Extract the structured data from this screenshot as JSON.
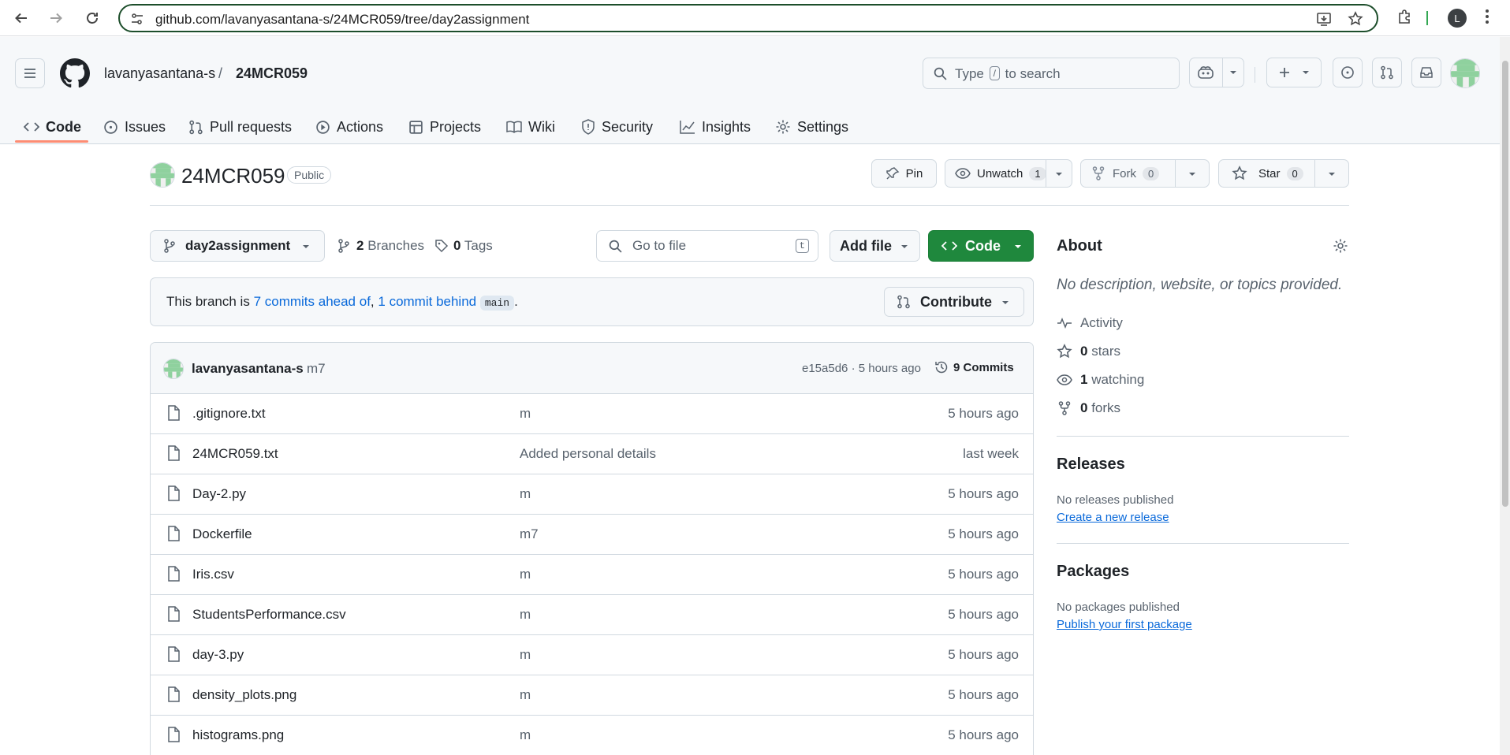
{
  "browser": {
    "url": "github.com/lavanyasantana-s/24MCR059/tree/day2assignment",
    "profile_initial": "L"
  },
  "header": {
    "owner": "lavanyasantana-s",
    "separator": "/",
    "repo": "24MCR059",
    "search_prefix": "Type",
    "search_key": "/",
    "search_suffix": "to search"
  },
  "tabs": [
    {
      "label": "Code",
      "icon": "code-icon"
    },
    {
      "label": "Issues",
      "icon": "issue-icon"
    },
    {
      "label": "Pull requests",
      "icon": "pull-request-icon"
    },
    {
      "label": "Actions",
      "icon": "play-icon"
    },
    {
      "label": "Projects",
      "icon": "table-icon"
    },
    {
      "label": "Wiki",
      "icon": "book-icon"
    },
    {
      "label": "Security",
      "icon": "shield-icon"
    },
    {
      "label": "Insights",
      "icon": "graph-icon"
    },
    {
      "label": "Settings",
      "icon": "gear-icon"
    }
  ],
  "repo": {
    "name": "24MCR059",
    "visibility": "Public",
    "pin_label": "Pin",
    "unwatch_label": "Unwatch",
    "watch_count": "1",
    "fork_label": "Fork",
    "fork_count": "0",
    "star_label": "Star",
    "star_count": "0"
  },
  "toolbar": {
    "branch": "day2assignment",
    "branches_count": "2",
    "branches_label": "Branches",
    "tags_count": "0",
    "tags_label": "Tags",
    "goto_placeholder": "Go to file",
    "goto_key": "t",
    "add_file": "Add file",
    "code": "Code"
  },
  "notice": {
    "prefix": "This branch is",
    "ahead": "7 commits ahead of",
    "comma": ",",
    "behind": "1 commit behind",
    "base": "main",
    "period": ".",
    "contribute": "Contribute"
  },
  "latest_commit": {
    "author": "lavanyasantana-s",
    "message": "m7",
    "hash_time": "e15a5d6 · 5 hours ago",
    "commits": "9 Commits"
  },
  "files": [
    {
      "name": ".gitignore.txt",
      "message": "m",
      "date": "5 hours ago"
    },
    {
      "name": "24MCR059.txt",
      "message": "Added personal details",
      "date": "last week"
    },
    {
      "name": "Day-2.py",
      "message": "m",
      "date": "5 hours ago"
    },
    {
      "name": "Dockerfile",
      "message": "m7",
      "date": "5 hours ago"
    },
    {
      "name": "Iris.csv",
      "message": "m",
      "date": "5 hours ago"
    },
    {
      "name": "StudentsPerformance.csv",
      "message": "m",
      "date": "5 hours ago"
    },
    {
      "name": "day-3.py",
      "message": "m",
      "date": "5 hours ago"
    },
    {
      "name": "density_plots.png",
      "message": "m",
      "date": "5 hours ago"
    },
    {
      "name": "histograms.png",
      "message": "m",
      "date": "5 hours ago"
    }
  ],
  "about": {
    "title": "About",
    "description": "No description, website, or topics provided.",
    "activity": "Activity",
    "stars_count": "0",
    "stars_label": "stars",
    "watching_count": "1",
    "watching_label": "watching",
    "forks_count": "0",
    "forks_label": "forks"
  },
  "releases": {
    "title": "Releases",
    "empty": "No releases published",
    "link": "Create a new release"
  },
  "packages": {
    "title": "Packages",
    "empty": "No packages published",
    "link": "Publish your first package"
  },
  "colors": {
    "accent_green": "#1f883d",
    "link_blue": "#0969da",
    "tab_underline": "#fd8c73",
    "avatar_green": "#8fd19e"
  }
}
